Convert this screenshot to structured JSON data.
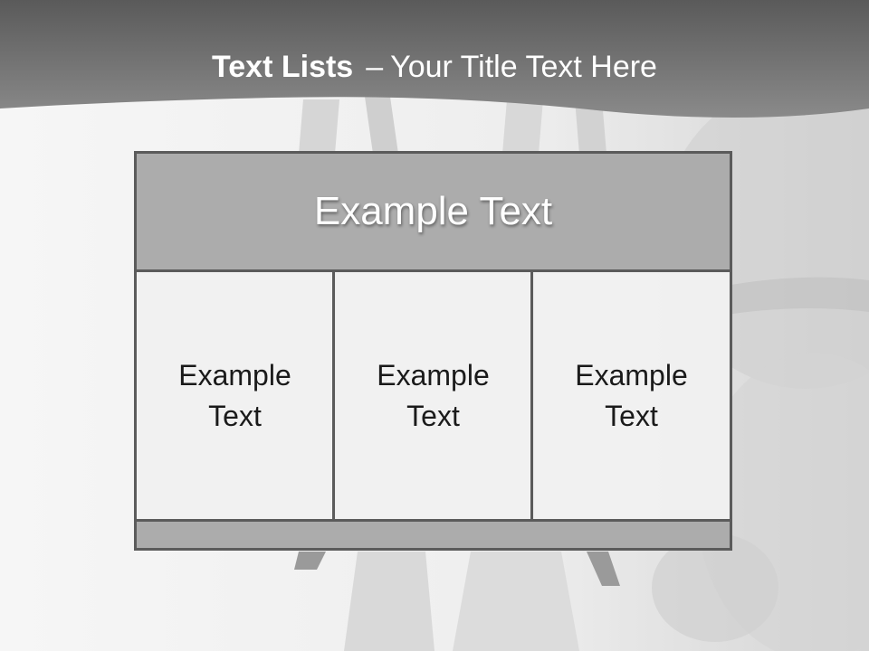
{
  "slide": {
    "title_bold": "Text Lists",
    "title_separator": "–",
    "title_rest": "Your Title Text Here"
  },
  "diagram": {
    "header": "Example Text",
    "columns": [
      {
        "line1": "Example",
        "line2": "Text"
      },
      {
        "line1": "Example",
        "line2": "Text"
      },
      {
        "line1": "Example",
        "line2": "Text"
      }
    ]
  },
  "colors": {
    "title_band": "#5f5f5f",
    "box_fill": "#acacac",
    "box_border": "#5b5b5b",
    "column_fill": "#f1f1f1"
  }
}
